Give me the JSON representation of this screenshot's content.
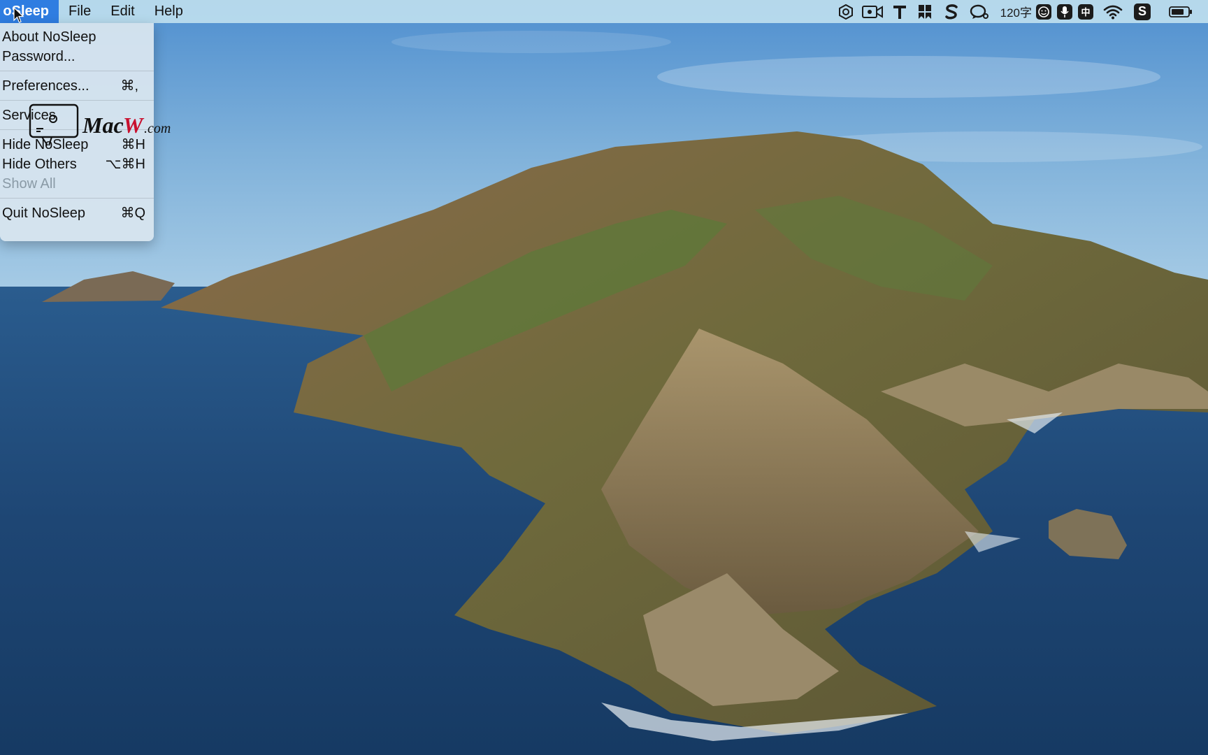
{
  "menubar": {
    "app_name": "oSleep",
    "menus": [
      "File",
      "Edit",
      "Help"
    ],
    "status_items": [
      {
        "icon": "app-hexagon-icon"
      },
      {
        "icon": "video-camera-icon"
      },
      {
        "icon": "text-t-icon"
      },
      {
        "icon": "bookmark-grid-icon"
      },
      {
        "icon": "s-logo-icon"
      },
      {
        "icon": "chat-bubble-icon"
      },
      {
        "icon": "word-count",
        "label": "120字"
      },
      {
        "icon": "emoji-face-icon"
      },
      {
        "icon": "microphone-icon"
      },
      {
        "icon": "input-method-icon",
        "label": "中"
      },
      {
        "icon": "wifi-icon"
      },
      {
        "icon": "sogou-s-icon"
      },
      {
        "icon": "battery-icon"
      }
    ]
  },
  "dropdown": {
    "groups": [
      [
        {
          "label": "About NoSleep",
          "shortcut": ""
        },
        {
          "label": "Password...",
          "shortcut": ""
        }
      ],
      [
        {
          "label": "Preferences...",
          "shortcut": "⌘,"
        }
      ],
      [
        {
          "label": "Services",
          "shortcut": ""
        }
      ],
      [
        {
          "label": "Hide NoSleep",
          "shortcut": "⌘H"
        },
        {
          "label": "Hide Others",
          "shortcut": "⌥⌘H"
        },
        {
          "label": "Show All",
          "shortcut": "",
          "disabled": true
        }
      ],
      [
        {
          "label": "Quit NoSleep",
          "shortcut": "⌘Q"
        }
      ]
    ]
  },
  "watermark": {
    "brand": "MacW",
    "suffix": ".com"
  },
  "colors": {
    "sky": "#6fa6d4",
    "sea": "#1e4a78",
    "menu_highlight": "#2f7de1"
  }
}
